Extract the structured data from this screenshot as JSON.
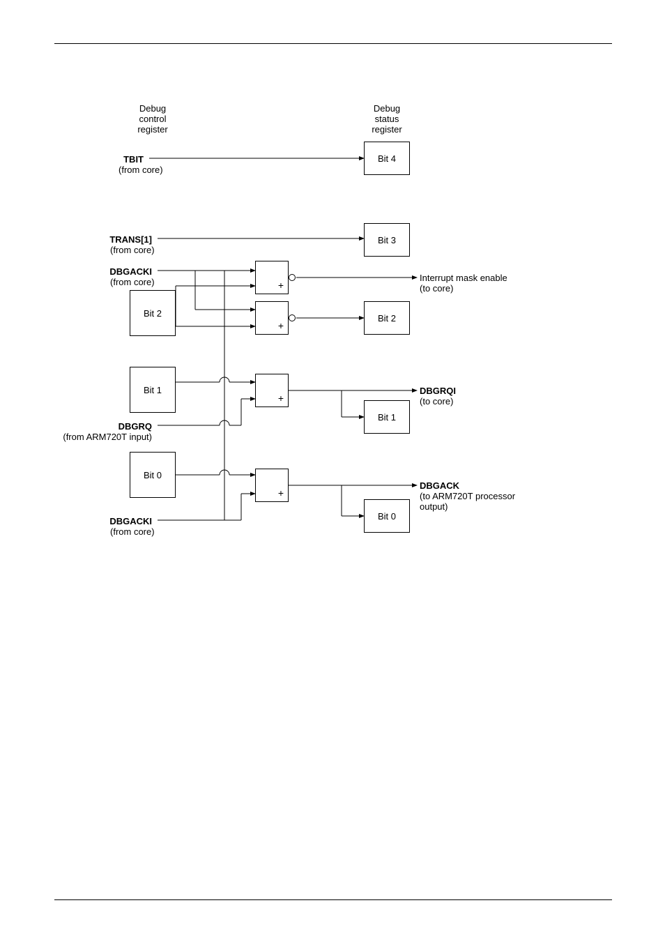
{
  "headers": {
    "control": "Debug\ncontrol\nregister",
    "status": "Debug\nstatus\nregister"
  },
  "signals": {
    "tbit": {
      "name": "TBIT",
      "from": "(from core)"
    },
    "trans1": {
      "name": "TRANS[1]",
      "from": "(from core)"
    },
    "dbgacki_a": {
      "name": "DBGACKI",
      "from": "(from core)"
    },
    "dbgrq": {
      "name": "DBGRQ",
      "from": "(from ARM720T input)"
    },
    "dbgacki_b": {
      "name": "DBGACKI",
      "from": "(from core)"
    }
  },
  "control_bits": {
    "bit2": "Bit 2",
    "bit1": "Bit 1",
    "bit0": "Bit 0"
  },
  "status_bits": {
    "bit4": "Bit 4",
    "bit3": "Bit 3",
    "bit2": "Bit 2",
    "bit1": "Bit 1",
    "bit0": "Bit 0"
  },
  "outputs": {
    "intmask": {
      "label": "Interrupt mask enable",
      "to": "(to core)"
    },
    "dbgrqi": {
      "name": "DBGRQI",
      "to": "(to core)"
    },
    "dbgack": {
      "name": "DBGACK",
      "to": "(to ARM720T processor\noutput)"
    }
  },
  "gate_symbol": "+"
}
